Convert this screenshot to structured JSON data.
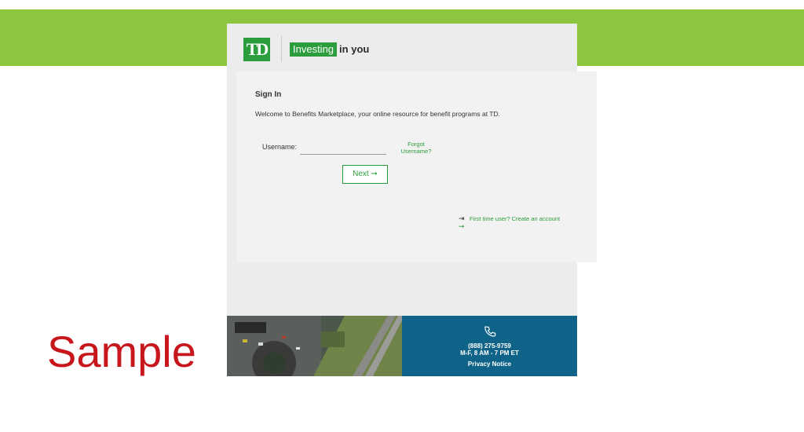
{
  "brand": {
    "logo_text": "TD",
    "tagline_highlight": "Investing",
    "tagline_rest": "in you",
    "colors": {
      "green": "#2c9d3c",
      "band": "#8cc63f",
      "footer_blue": "#0f6388"
    }
  },
  "signin": {
    "title": "Sign In",
    "welcome": "Welcome to Benefits Marketplace, your online resource for benefit programs at TD.",
    "username_label": "Username:",
    "username_value": "",
    "forgot_username": "Forgot Username?",
    "next_label": "Next",
    "first_time_label": "First time user? Create an account"
  },
  "footer": {
    "phone": "(888) 275-9759",
    "hours": "M-F, 8 AM - 7 PM ET",
    "privacy": "Privacy Notice",
    "icons": [
      "phone-icon"
    ]
  },
  "overlay": {
    "sample_label": "Sample"
  }
}
